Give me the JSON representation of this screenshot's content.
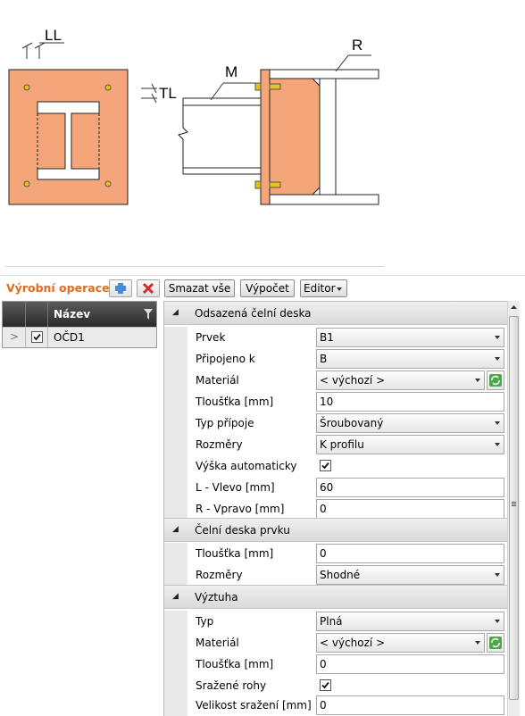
{
  "drawing": {
    "labels": {
      "ll": "LL",
      "tl": "TL",
      "m": "M",
      "r": "R"
    }
  },
  "toolbar": {
    "title": "Výrobní operace",
    "add_icon": "add-icon",
    "delete_icon": "delete-icon",
    "delete_all_label": "Smazat vše",
    "compute_label": "Výpočet",
    "editor_label": "Editor"
  },
  "grid": {
    "header": "Název",
    "filter_icon": "filter-icon",
    "rows": [
      {
        "name": "OČD1",
        "checked": true
      }
    ]
  },
  "props": {
    "cat1": {
      "label": "Odsazená čelní deska"
    },
    "prvek": {
      "label": "Prvek",
      "value": "B1"
    },
    "pripojeno": {
      "label": "Připojeno k",
      "value": "B"
    },
    "material1": {
      "label": "Materiál",
      "value": "< výchozí >"
    },
    "tloustka1": {
      "label": "Tloušťka [mm]",
      "value": "10"
    },
    "typ_pripoje": {
      "label": "Typ přípoje",
      "value": "Šroubovaný"
    },
    "rozmery1": {
      "label": "Rozměry",
      "value": "K profilu"
    },
    "vyska": {
      "label": "Výška automaticky",
      "checked": true
    },
    "lvlevo": {
      "label": "L - Vlevo [mm]",
      "value": "60"
    },
    "rvpravo": {
      "label": "R - Vpravo [mm]",
      "value": "0"
    },
    "cat2": {
      "label": "Čelní deska prvku"
    },
    "tloustka2": {
      "label": "Tloušťka [mm]",
      "value": "0"
    },
    "rozmery2": {
      "label": "Rozměry",
      "value": "Shodné"
    },
    "cat3": {
      "label": "Výztuha"
    },
    "typ": {
      "label": "Typ",
      "value": "Plná"
    },
    "material2": {
      "label": "Materiál",
      "value": "< výchozí >"
    },
    "tloustka3": {
      "label": "Tloušťka [mm]",
      "value": "0"
    },
    "srazene": {
      "label": "Sražené rohy",
      "checked": true
    },
    "velikost": {
      "label": "Velikost sražení [mm]",
      "value": "0"
    }
  },
  "colors": {
    "plate": "#f4a57a",
    "accent": "#e46a1e",
    "bolt": "#e8c21a"
  }
}
